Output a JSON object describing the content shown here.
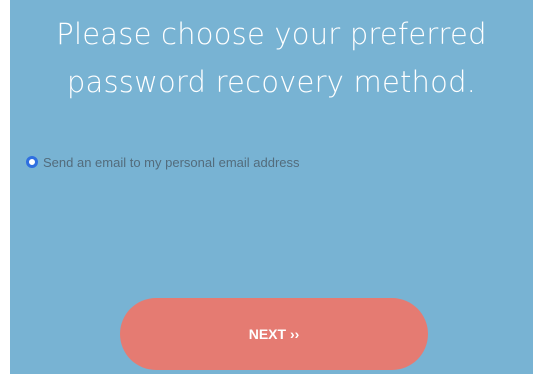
{
  "heading": {
    "line1": "Please choose your preferred",
    "line2": "password recovery method."
  },
  "recovery_options": [
    {
      "label": "Send an email to my personal email address",
      "selected": true
    }
  ],
  "next_button": {
    "label": "NEXT ››"
  },
  "colors": {
    "background": "#78b3d3",
    "button": "#e57b72",
    "radio_accent": "#2f6fe0",
    "option_text": "#536c7c"
  }
}
